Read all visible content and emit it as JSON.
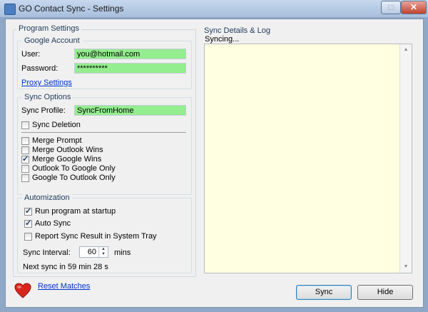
{
  "window": {
    "title": "GO Contact Sync - Settings",
    "minimize_icon": "minimize-icon",
    "close_icon": "close-icon",
    "maximize_glyph": "□",
    "close_glyph": "✕"
  },
  "program_settings": {
    "legend": "Program Settings",
    "google_account": {
      "legend": "Google Account",
      "user_label": "User:",
      "user_value": "you@hotmail.com",
      "password_label": "Password:",
      "password_value": "**********",
      "proxy_link": "Proxy Settings",
      "field_color": "#94ed8e"
    },
    "sync_options": {
      "legend": "Sync Options",
      "profile_label": "Sync Profile:",
      "profile_value": "SyncFromHome",
      "sync_deletion": {
        "label": "Sync Deletion",
        "checked": false
      },
      "modes": [
        {
          "label": "Merge Prompt",
          "checked": false
        },
        {
          "label": "Merge Outlook Wins",
          "checked": false
        },
        {
          "label": "Merge Google Wins",
          "checked": true
        },
        {
          "label": "Outlook To Google Only",
          "checked": false
        },
        {
          "label": "Google To Outlook Only",
          "checked": false
        }
      ]
    },
    "automization": {
      "legend": "Automization",
      "run_at_startup": {
        "label": "Run program at startup",
        "checked": true
      },
      "auto_sync": {
        "label": "Auto Sync",
        "checked": true
      },
      "report_sync": {
        "label": "Report Sync Result in System Tray",
        "checked": false
      },
      "interval_label": "Sync Interval:",
      "interval_value": "60",
      "interval_unit": "mins",
      "next_sync": "Next sync in 59 min 28 s"
    }
  },
  "log_panel": {
    "legend": "Sync Details & Log",
    "status": "Syncing...",
    "background": "#ffffe1"
  },
  "footer": {
    "heart_icon": "heart-icon",
    "reset_link": "Reset Matches",
    "sync_button": "Sync",
    "hide_button": "Hide"
  }
}
